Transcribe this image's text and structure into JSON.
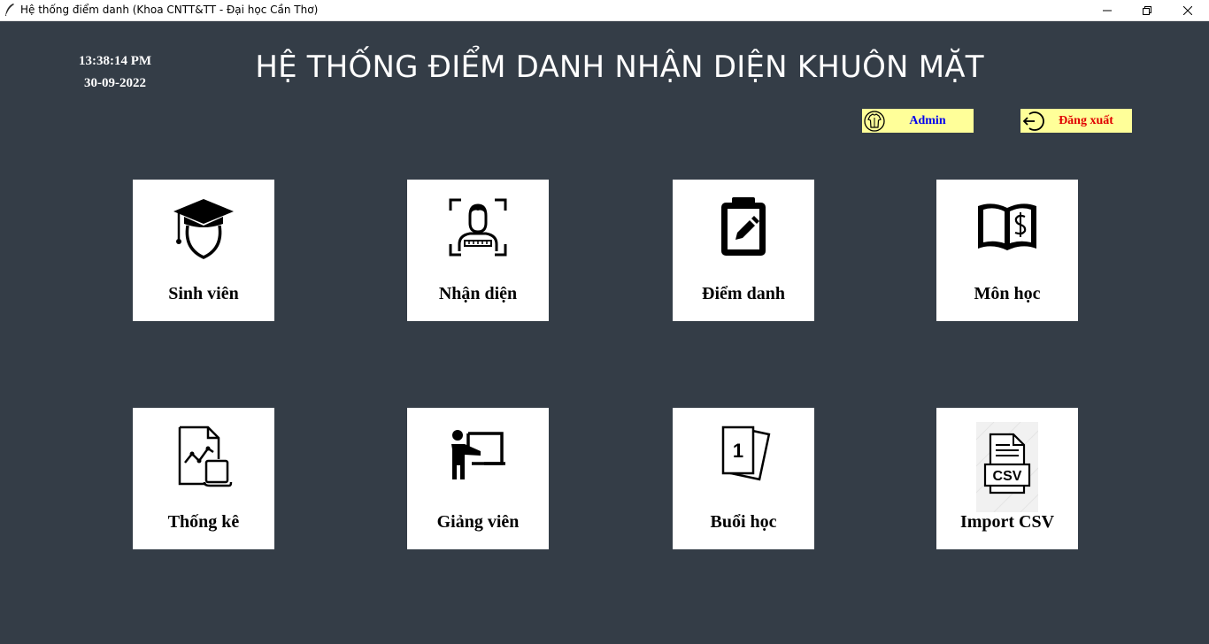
{
  "window": {
    "title": "Hệ thống điểm danh (Khoa CNTT&TT - Đại học Cần Thơ)",
    "app_icon": "feather-icon",
    "controls": [
      "minimize-icon",
      "restore-icon",
      "close-icon"
    ]
  },
  "clock": {
    "time": "13:38:14 PM",
    "date": "30-09-2022"
  },
  "header": {
    "title": "HỆ THỐNG ĐIỂM DANH NHẬN DIỆN KHUÔN MẶT"
  },
  "user_bar": {
    "admin_label": "Admin",
    "admin_icon": "user-shirt-icon",
    "logout_label": "Đăng xuất",
    "logout_icon": "logout-icon"
  },
  "tiles": [
    {
      "label": "Sinh viên",
      "icon": "graduate-icon"
    },
    {
      "label": "Nhận diện",
      "icon": "face-scan-icon"
    },
    {
      "label": "Điểm danh",
      "icon": "clipboard-edit-icon"
    },
    {
      "label": "Môn học",
      "icon": "book-dollar-icon"
    },
    {
      "label": "Thống kê",
      "icon": "report-chart-icon"
    },
    {
      "label": "Giảng viên",
      "icon": "teacher-board-icon"
    },
    {
      "label": "Buổi học",
      "icon": "session-cards-icon"
    },
    {
      "label": "Import CSV",
      "icon": "csv-file-icon"
    }
  ],
  "colors": {
    "background": "#343d47",
    "tile": "#ffffff",
    "pill": "#ffff99",
    "admin_text": "#0000ee",
    "logout_text": "#e00000"
  }
}
